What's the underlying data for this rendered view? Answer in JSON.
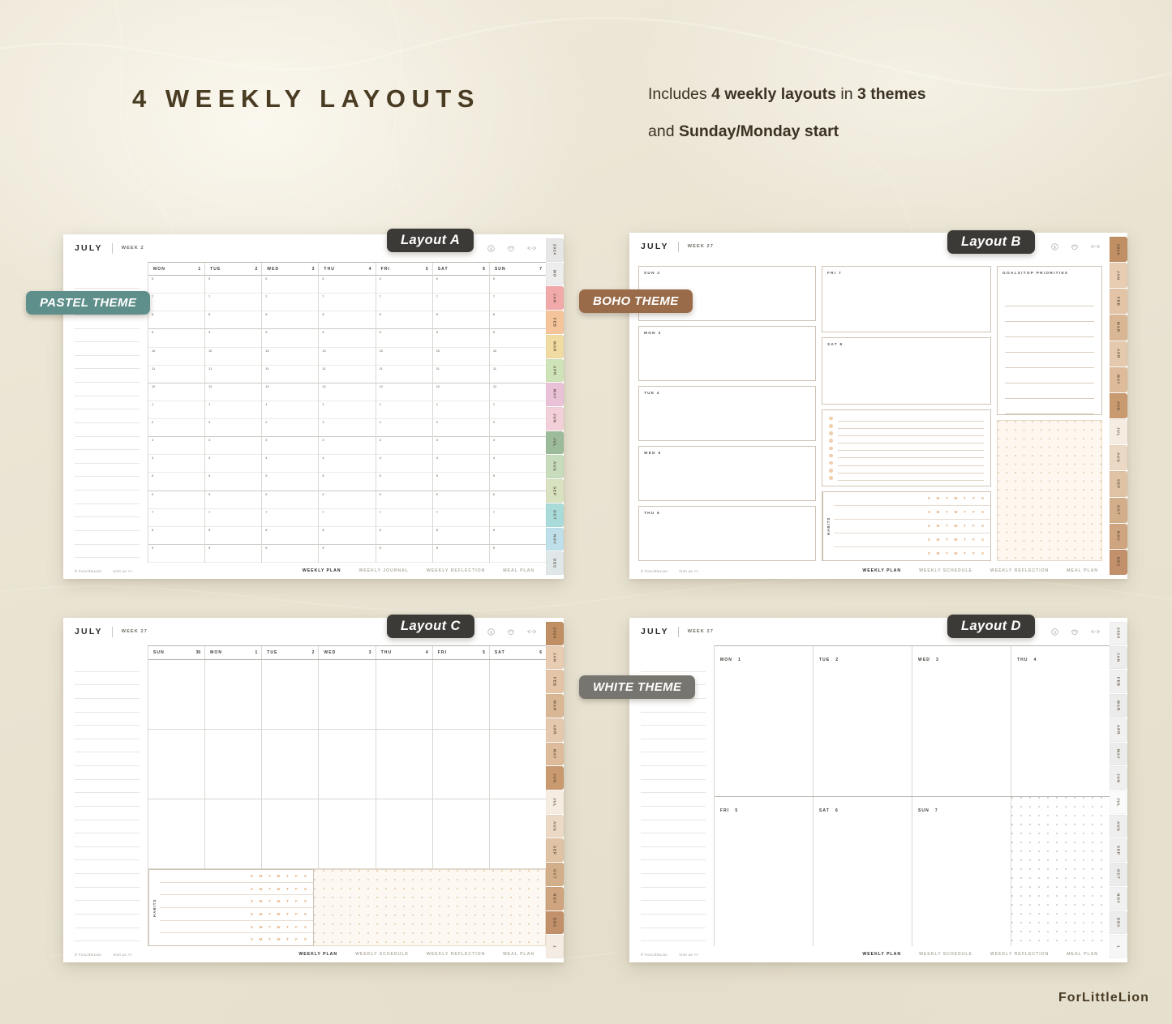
{
  "page": {
    "title": "4 WEEKLY LAYOUTS",
    "subtitle_line1_pre": "Includes ",
    "subtitle_line1_b1": "4 weekly layouts",
    "subtitle_line1_mid": " in ",
    "subtitle_line1_b2": "3 themes",
    "subtitle_line2_pre": "and ",
    "subtitle_line2_b1": "Sunday/Monday start",
    "brand": "ForLittleLion",
    "background_color": "#eae5d4",
    "title_color": "#4a3c23"
  },
  "badges": {
    "layout_a": "Layout A",
    "layout_b": "Layout B",
    "layout_c": "Layout C",
    "layout_d": "Layout D",
    "theme_pastel": "PASTEL THEME",
    "theme_boho": "BOHO THEME",
    "theme_white": "WHITE THEME",
    "color_pastel": "#5f8f8a",
    "color_boho": "#9a6b49",
    "color_white": "#77756f",
    "color_layout": "#3c3a37"
  },
  "common": {
    "month": "JULY",
    "copyright": "© ForLittleLion",
    "visit": "Visit us >>",
    "habits_label": "HABITS",
    "dow_initials": [
      "S",
      "M",
      "T",
      "W",
      "T",
      "F",
      "S"
    ]
  },
  "planner_a": {
    "month": "JULY",
    "week": "WEEK 2",
    "days": [
      {
        "name": "MON",
        "num": "1"
      },
      {
        "name": "TUE",
        "num": "2"
      },
      {
        "name": "WED",
        "num": "3"
      },
      {
        "name": "THU",
        "num": "4"
      },
      {
        "name": "FRI",
        "num": "5"
      },
      {
        "name": "SAT",
        "num": "6"
      },
      {
        "name": "SUN",
        "num": "7"
      }
    ],
    "hours": [
      "6",
      "7",
      "8",
      "9",
      "10",
      "11",
      "12",
      "1",
      "2",
      "3",
      "4",
      "5",
      "6",
      "7",
      "8",
      "9"
    ],
    "footer_nav": [
      "WEEKLY PLAN",
      "WEEKLY JOURNAL",
      "WEEKLY REFLECTION",
      "MEAL PLAN"
    ],
    "footer_active": "WEEKLY PLAN",
    "tabs": [
      "2024",
      "MO",
      "JAN",
      "FEB",
      "MAR",
      "APR",
      "MAY",
      "JUN",
      "JUL",
      "AUG",
      "SEP",
      "OCT",
      "NOV",
      "DEC"
    ],
    "tab_colors": [
      "#e6e6e6",
      "#ededed",
      "#f2a9a9",
      "#f6c49a",
      "#f0dba2",
      "#cfe3b9",
      "#e9c2d8",
      "#f2cfd9",
      "#9cbb9a",
      "#c6dcbd",
      "#d9e2c0",
      "#a8dbd9",
      "#bfe0ea",
      "#dfe7e9"
    ]
  },
  "planner_b": {
    "month": "JULY",
    "week": "WEEK 27",
    "day_boxes_left": [
      {
        "name": "SUN",
        "num": "2"
      },
      {
        "name": "MON",
        "num": "3"
      },
      {
        "name": "TUE",
        "num": "4"
      },
      {
        "name": "WED",
        "num": "5"
      },
      {
        "name": "THU",
        "num": "6"
      }
    ],
    "day_boxes_mid": [
      {
        "name": "FRI",
        "num": "7"
      },
      {
        "name": "SAT",
        "num": "8"
      }
    ],
    "goals_label": "GOALS/TOP PRIORITIES",
    "habits_label": "HABITS",
    "footer_nav": [
      "WEEKLY PLAN",
      "WEEKLY SCHEDULE",
      "WEEKLY REFLECTION",
      "MEAL PLAN"
    ],
    "footer_active": "WEEKLY PLAN",
    "tabs": [
      "2024",
      "JAN",
      "FEB",
      "MAR",
      "APR",
      "MAY",
      "JUN",
      "JUL",
      "AUG",
      "SEP",
      "OCT",
      "NOV",
      "DEC"
    ],
    "tab_colors": [
      "#c08f63",
      "#e8cdb3",
      "#e3c4a6",
      "#d9b794",
      "#e5c9ae",
      "#ddbb9b",
      "#c99a6f",
      "#f6ede2",
      "#ecd9c5",
      "#e0c3a5",
      "#d3ae8b",
      "#cfa57f",
      "#c2906a"
    ]
  },
  "planner_c": {
    "month": "JULY",
    "week": "WEEK 27",
    "days": [
      {
        "name": "SUN",
        "num": "30"
      },
      {
        "name": "MON",
        "num": "1"
      },
      {
        "name": "TUE",
        "num": "2"
      },
      {
        "name": "WED",
        "num": "3"
      },
      {
        "name": "THU",
        "num": "4"
      },
      {
        "name": "FRI",
        "num": "5"
      },
      {
        "name": "SAT",
        "num": "6"
      }
    ],
    "habits_label": "HABITS",
    "habit_rows": 6,
    "footer_nav": [
      "WEEKLY PLAN",
      "WEEKLY SCHEDULE",
      "WEEKLY REFLECTION",
      "MEAL PLAN"
    ],
    "footer_active": "WEEKLY PLAN",
    "tabs": [
      "2024",
      "JAN",
      "FEB",
      "MAR",
      "APR",
      "MAY",
      "JUN",
      "JUL",
      "AUG",
      "SEP",
      "OCT",
      "NOV",
      "DEC",
      "1"
    ],
    "tab_colors": [
      "#c08f63",
      "#e8cdb3",
      "#e3c4a6",
      "#d9b794",
      "#e5c9ae",
      "#ddbb9b",
      "#c99a6f",
      "#f6ede2",
      "#ecd9c5",
      "#e0c3a5",
      "#d3ae8b",
      "#cfa57f",
      "#c2906a",
      "#f4ece2"
    ]
  },
  "planner_d": {
    "month": "JULY",
    "week": "WEEK 27",
    "row1": [
      {
        "name": "MON",
        "num": "1"
      },
      {
        "name": "TUE",
        "num": "2"
      },
      {
        "name": "WED",
        "num": "3"
      },
      {
        "name": "THU",
        "num": "4"
      }
    ],
    "row2": [
      {
        "name": "FRI",
        "num": "5"
      },
      {
        "name": "SAT",
        "num": "6"
      },
      {
        "name": "SUN",
        "num": "7"
      }
    ],
    "footer_nav": [
      "WEEKLY PLAN",
      "WEEKLY SCHEDULE",
      "WEEKLY REFLECTION",
      "MEAL PLAN"
    ],
    "footer_active": "WEEKLY PLAN",
    "tabs": [
      "2024",
      "JAN",
      "FEB",
      "MAR",
      "APR",
      "MAY",
      "JUN",
      "JUL",
      "AUG",
      "SEP",
      "OCT",
      "NOV",
      "DEC",
      "1"
    ],
    "tab_colors": [
      "#f2f2f2",
      "#ededed",
      "#f0f0f0",
      "#ebebeb",
      "#f1f1f1",
      "#ececec",
      "#efefef",
      "#fafafa",
      "#eeeeee",
      "#f0f0f0",
      "#ebebeb",
      "#f1f1f1",
      "#ededed",
      "#f6f6f6"
    ]
  },
  "icons": {
    "dollar": "dollar-circle-icon",
    "smile": "smiley-icon",
    "arrows": "arrows-icon"
  }
}
